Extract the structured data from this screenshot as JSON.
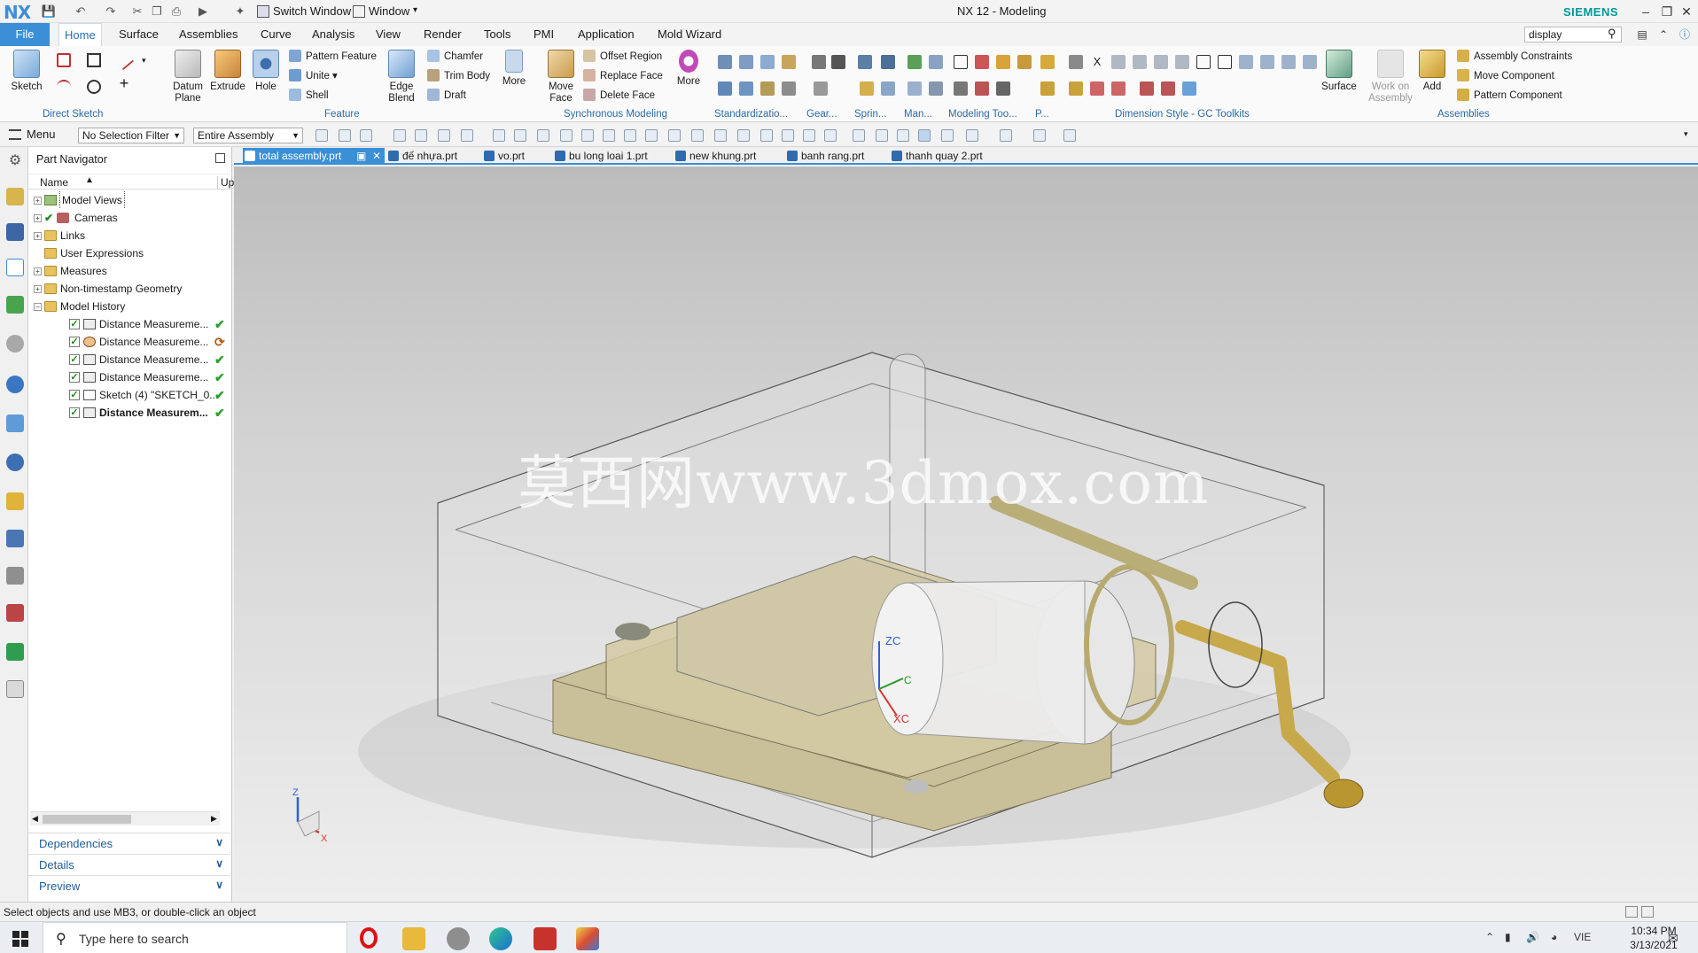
{
  "titlebar": {
    "logo": "NX",
    "switch_window": "Switch Window",
    "window": "Window",
    "title": "NX 12 - Modeling",
    "brand": "SIEMENS"
  },
  "tabs": {
    "file": "File",
    "items": [
      "Home",
      "Surface",
      "Assemblies",
      "Curve",
      "Analysis",
      "View",
      "Render",
      "Tools",
      "PMI",
      "Application",
      "Mold Wizard"
    ],
    "search": "display"
  },
  "ribbon": {
    "sketch": "Sketch",
    "datum": "Datum",
    "plane": "Plane",
    "extrude": "Extrude",
    "hole": "Hole",
    "pattern_feature": "Pattern Feature",
    "unite": "Unite",
    "shell": "Shell",
    "edge": "Edge",
    "blend": "Blend",
    "chamfer": "Chamfer",
    "trim_body": "Trim Body",
    "draft": "Draft",
    "more1": "More",
    "move": "Move",
    "face": "Face",
    "offset_region": "Offset Region",
    "replace_face": "Replace Face",
    "delete_face": "Delete Face",
    "more2": "More",
    "surface": "Surface",
    "work_on": "Work on",
    "assembly": "Assembly",
    "add": "Add",
    "assembly_constraints": "Assembly Constraints",
    "move_component": "Move Component",
    "pattern_component": "Pattern Component",
    "groups": [
      "Direct Sketch",
      "Feature",
      "Synchronous Modeling",
      "Standardizatio...",
      "Gear...",
      "Sprin...",
      "Man...",
      "Modeling Too...",
      "P...",
      "Dimension Style - GC Toolkits",
      "Assemblies"
    ]
  },
  "cmdbar": {
    "menu": "Menu",
    "selection_filter": "No Selection Filter",
    "scope": "Entire Assembly"
  },
  "navigator": {
    "title": "Part Navigator",
    "col_name": "Name",
    "col_up": "Up",
    "rows": [
      {
        "label": "Model Views"
      },
      {
        "label": "Cameras"
      },
      {
        "label": "Links"
      },
      {
        "label": "User Expressions"
      },
      {
        "label": "Measures"
      },
      {
        "label": "Non-timestamp Geometry"
      },
      {
        "label": "Model History"
      },
      {
        "label": "Distance Measureme..."
      },
      {
        "label": "Distance Measureme..."
      },
      {
        "label": "Distance Measureme..."
      },
      {
        "label": "Distance Measureme..."
      },
      {
        "label": "Sketch (4) \"SKETCH_0..."
      },
      {
        "label": "Distance Measurem..."
      }
    ],
    "panels": [
      "Dependencies",
      "Details",
      "Preview"
    ]
  },
  "doc_tabs": [
    "total assembly.prt",
    "đế nhựa.prt",
    "vo.prt",
    "bu long loai 1.prt",
    "new khung.prt",
    "banh rang.prt",
    "thanh quay 2.prt"
  ],
  "viewport": {
    "watermark": "莫西网www.3dmox.com",
    "axis_z": "ZC",
    "axis_x": "XC",
    "axis_y": "C",
    "triad_z": "Z",
    "triad_x": "X"
  },
  "status": {
    "text": "Select objects and use MB3, or double-click an object"
  },
  "taskbar": {
    "search_placeholder": "Type here to search",
    "lang": "VIE",
    "time": "10:34 PM",
    "date": "3/13/2021"
  }
}
